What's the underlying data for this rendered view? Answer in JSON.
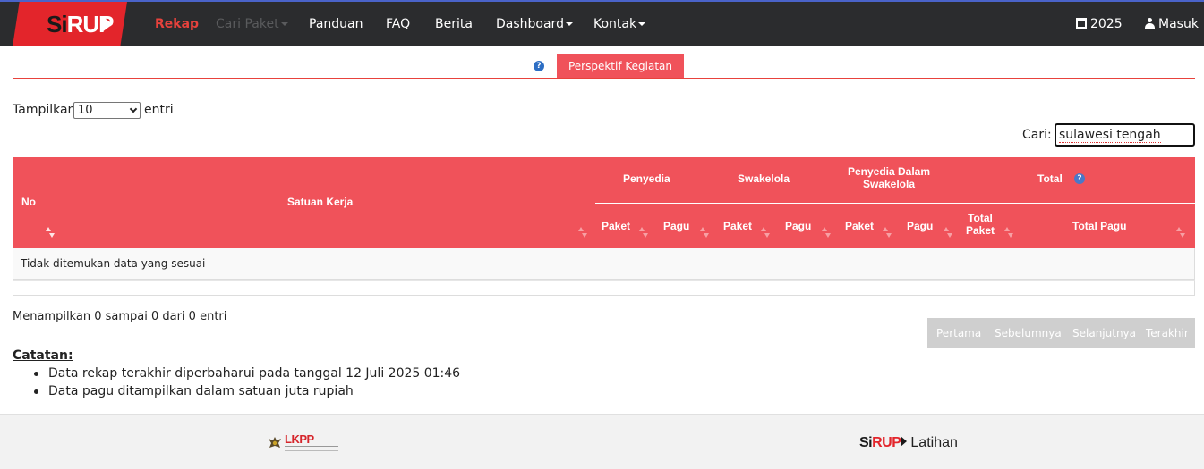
{
  "brand": {
    "si": "Si",
    "rup": "RUP"
  },
  "nav": {
    "items": [
      {
        "label": "Rekap",
        "state": "active"
      },
      {
        "label": "Cari Paket",
        "state": "disabled"
      },
      {
        "label": "Panduan",
        "state": "normal"
      },
      {
        "label": "FAQ",
        "state": "normal"
      },
      {
        "label": "Berita",
        "state": "normal"
      },
      {
        "label": "Dashboard",
        "state": "normal"
      },
      {
        "label": "Kontak",
        "state": "normal"
      }
    ],
    "year": "2025",
    "login": "Masuk"
  },
  "tabs": {
    "help_glyph": "?",
    "active_label": "Perspektif Kegiatan"
  },
  "controls": {
    "show_label": "Tampilkan",
    "page_size": "10",
    "entries_label": "entri",
    "search_label": "Cari:",
    "search_value": "sulawesi tengah"
  },
  "table": {
    "head": {
      "no": "No",
      "satker": "Satuan Kerja",
      "penyedia": "Penyedia",
      "swakelola": "Swakelola",
      "penyedia_dalam_swakelola_1": "Penyedia Dalam",
      "penyedia_dalam_swakelola_2": "Swakelola",
      "total": "Total",
      "total_help": "?",
      "paket": "Paket",
      "pagu": "Pagu",
      "total_paket_1": "Total",
      "total_paket_2": "Paket",
      "total_pagu": "Total Pagu"
    },
    "empty_message": "Tidak ditemukan data yang sesuai"
  },
  "info": "Menampilkan 0 sampai 0 dari 0 entri",
  "pagination": {
    "first": "Pertama",
    "prev": "Sebelumnya",
    "next": "Selanjutnya",
    "last": "Terakhir"
  },
  "notes": {
    "title": "Catatan:",
    "items": [
      "Data rekap terakhir diperbaharui pada tanggal 12 Juli 2025 01:46",
      "Data pagu ditampilkan dalam satuan juta rupiah"
    ]
  },
  "footer": {
    "lkpp_logo_text": "LKPP",
    "brand_si": "Si",
    "brand_rup": "RUP",
    "brand_suffix": "Latihan"
  },
  "colors": {
    "navbar_bg": "#2b2c2e",
    "brand_red": "#e3252b",
    "accent_red": "#f0525a",
    "active_nav": "#e8423c",
    "pagination_disabled": "#cfcfcf",
    "help_blue": "#2d6ec4"
  }
}
